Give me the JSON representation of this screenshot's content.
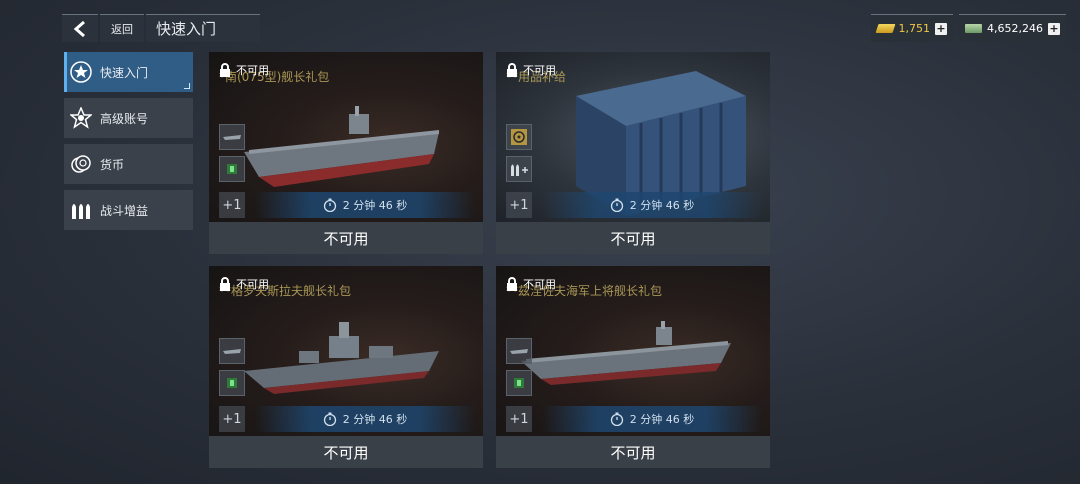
{
  "header": {
    "back_label": "返回",
    "title": "快速入门"
  },
  "currency": {
    "gold": "1,751",
    "cash": "4,652,246"
  },
  "sidebar": {
    "items": [
      {
        "label": "快速入门",
        "icon": "star-emblem-icon",
        "active": true
      },
      {
        "label": "高级账号",
        "icon": "star-badge-icon",
        "active": false
      },
      {
        "label": "货币",
        "icon": "coins-icon",
        "active": false
      },
      {
        "label": "战斗增益",
        "icon": "ammo-icon",
        "active": false
      }
    ]
  },
  "cards": [
    {
      "lock_label": "不可用",
      "title": "*南(075型)舰长礼包",
      "plus": "+1",
      "timer": "2 分钟 46 秒",
      "status": "不可用"
    },
    {
      "lock_label": "不可用",
      "title": "**用品补给",
      "plus": "+1",
      "timer": "2 分钟 46 秒",
      "status": "不可用"
    },
    {
      "lock_label": "不可用",
      "title": "**格罗夫斯拉夫舰长礼包",
      "plus": "+1",
      "timer": "2 分钟 46 秒",
      "status": "不可用"
    },
    {
      "lock_label": "不可用",
      "title": "**兹涅佐夫海军上将舰长礼包",
      "plus": "+1",
      "timer": "2 分钟 46 秒",
      "status": "不可用"
    }
  ]
}
